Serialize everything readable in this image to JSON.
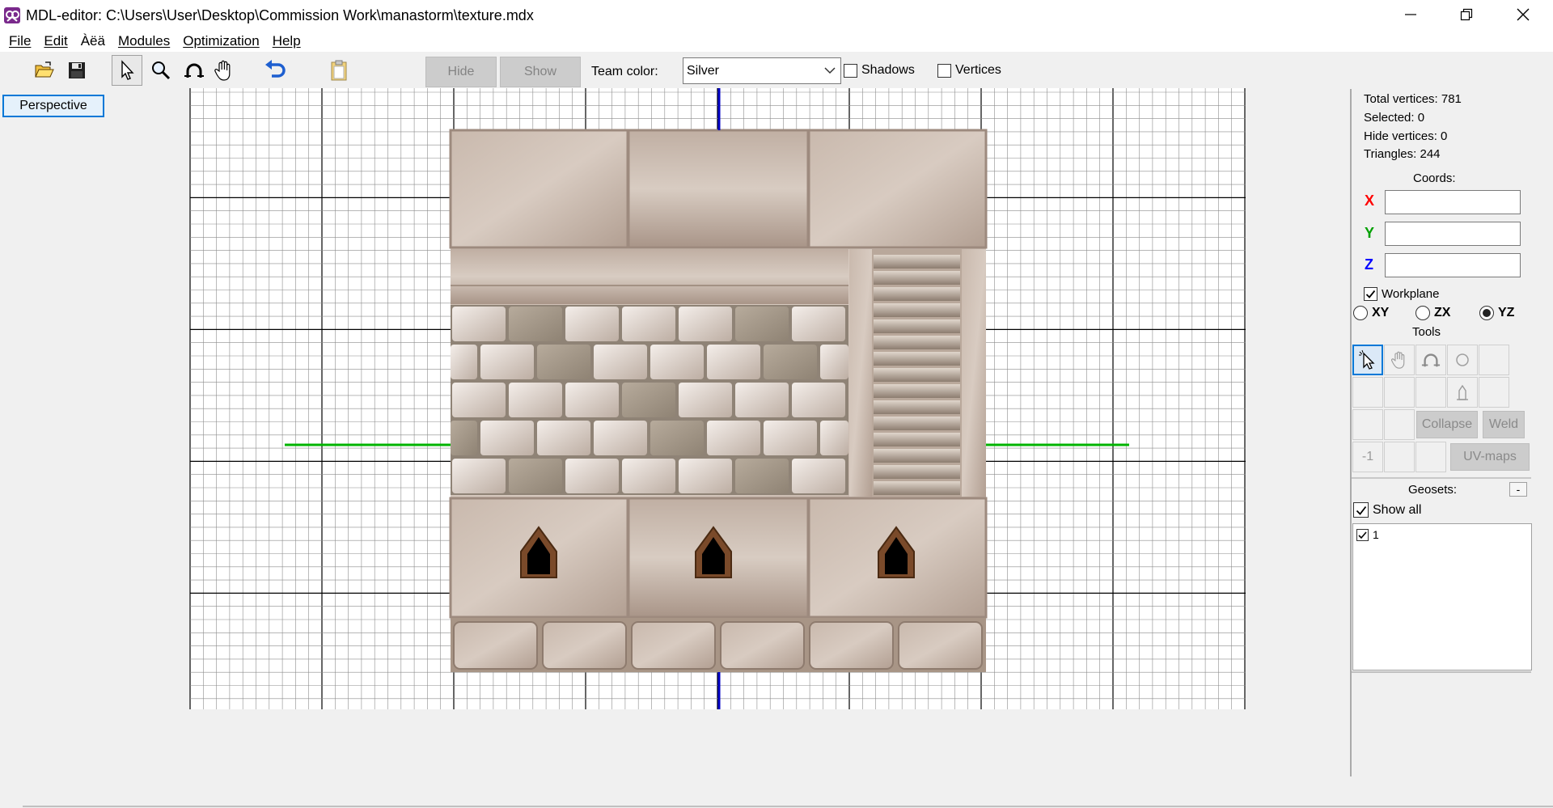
{
  "window": {
    "title": "MDL-editor: C:\\Users\\User\\Desktop\\Commission Work\\manastorm\\texture.mdx",
    "minimize_label": "–",
    "restore_label": "❐",
    "close_label": "✕"
  },
  "menu": {
    "file": "File",
    "edit": "Edit",
    "aea": "Àëä",
    "modules": "Modules",
    "optimization": "Optimization",
    "help": "Help"
  },
  "toolbar": {
    "hide_label": "Hide",
    "show_label": "Show",
    "team_color_label": "Team color:",
    "team_color_value": "Silver",
    "shadows_label": "Shadows",
    "vertices_label": "Vertices"
  },
  "viewport": {
    "perspective_label": "Perspective"
  },
  "panel": {
    "total_vertices": "Total vertices: 781",
    "selected": "Selected: 0",
    "hide_vertices": "Hide vertices: 0",
    "triangles": "Triangles: 244",
    "coords_label": "Coords:",
    "x_label": "X",
    "y_label": "Y",
    "z_label": "Z",
    "x_value": "",
    "y_value": "",
    "z_value": "",
    "workplane_label": "Workplane",
    "plane_xy": "XY",
    "plane_zx": "ZX",
    "plane_yz": "YZ",
    "tools_label": "Tools",
    "collapse_label": "Collapse",
    "weld_label": "Weld",
    "minus_one_label": "-1",
    "uvmaps_label": "UV-maps",
    "geosets_label": "Geosets:",
    "geosets_toggle": "-",
    "show_all_label": "Show all",
    "geoset_items": [
      "1"
    ]
  },
  "colors": {
    "x_axis": "#ff0000",
    "y_axis": "#00a000",
    "z_axis": "#0000ff",
    "grid_line": "#8c8c8c",
    "grid_major": "#000000",
    "blue_axis": "#0000c8",
    "green_axis": "#00b400",
    "accent": "#0078d7"
  },
  "icons": {
    "app": "manastorm-icon",
    "open": "open-folder-icon",
    "save": "floppy-disk-icon",
    "select": "arrow-cursor-icon",
    "zoom": "magnifier-icon",
    "rotate": "rotate-arc-icon",
    "pan": "hand-icon",
    "undo": "undo-arrow-icon",
    "paste": "clipboard-icon"
  }
}
